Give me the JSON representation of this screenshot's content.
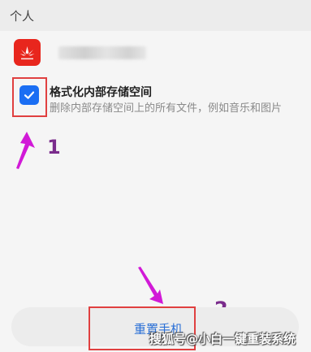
{
  "section": {
    "title": "个人"
  },
  "account": {
    "logo_icon": "huawei-logo",
    "name_hidden": true
  },
  "option": {
    "checked": true,
    "title": "格式化内部存储空间",
    "description": "删除内部存储空间上的所有文件，例如音乐和图片"
  },
  "annotations": {
    "step1": "1",
    "step2": "2"
  },
  "reset_button": {
    "label": "重置手机"
  },
  "watermark": {
    "text": "搜狐号@小白一键重装系统"
  },
  "colors": {
    "checkbox": "#1b6ef3",
    "button_text": "#2a6fd6",
    "logo": "#e8261d",
    "annotation": "#7a2c8c",
    "frame": "#e04040"
  }
}
